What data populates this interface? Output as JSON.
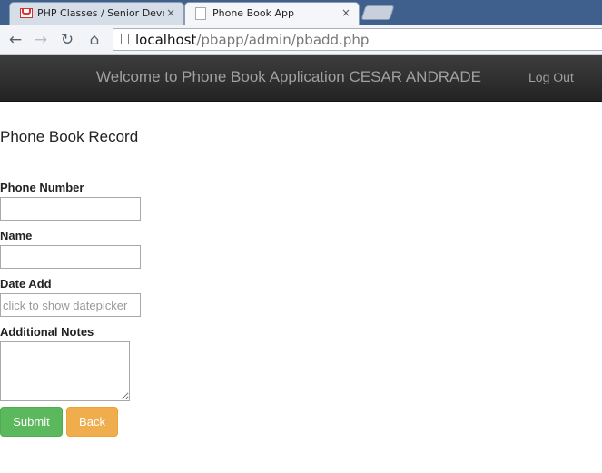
{
  "browser": {
    "tabs": [
      {
        "title": "PHP Classes / Senior Develop",
        "icon": "gmail-icon",
        "active": false
      },
      {
        "title": "Phone Book App",
        "icon": "page-icon",
        "active": true
      }
    ],
    "close_glyph": "×",
    "nav": {
      "back": "←",
      "forward": "→",
      "reload": "↻",
      "home": "⌂"
    },
    "address": {
      "host": "localhost",
      "path": "/pbapp/admin/pbadd.php"
    }
  },
  "navbar": {
    "welcome": "Welcome to Phone Book Application CESAR ANDRADE",
    "logout": "Log Out",
    "background": "#2b2b2b"
  },
  "form": {
    "title": "Phone Book Record",
    "fields": {
      "phone": {
        "label": "Phone Number",
        "value": ""
      },
      "name": {
        "label": "Name",
        "value": ""
      },
      "date": {
        "label": "Date Add",
        "placeholder": "click to show datepicker",
        "value": ""
      },
      "notes": {
        "label": "Additional Notes",
        "value": ""
      }
    },
    "buttons": {
      "submit": {
        "label": "Submit",
        "color": "#5cb85c"
      },
      "back": {
        "label": "Back",
        "color": "#f0ad4e"
      }
    }
  }
}
